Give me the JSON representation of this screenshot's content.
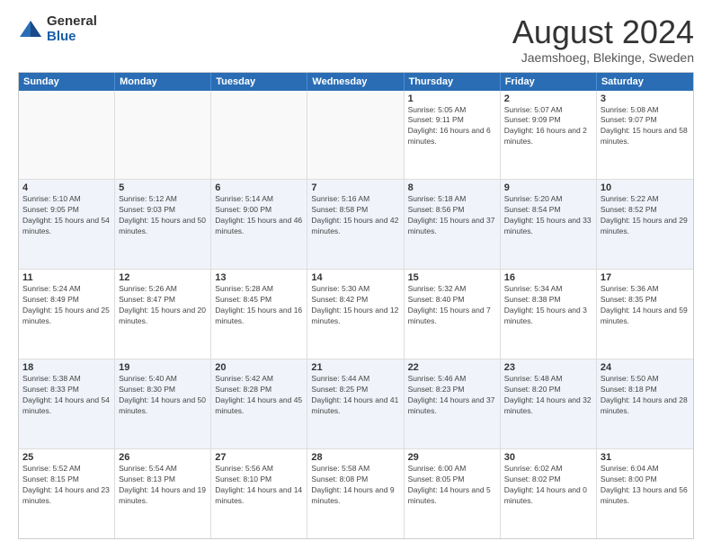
{
  "logo": {
    "general": "General",
    "blue": "Blue"
  },
  "title": "August 2024",
  "subtitle": "Jaemshoeg, Blekinge, Sweden",
  "dayNames": [
    "Sunday",
    "Monday",
    "Tuesday",
    "Wednesday",
    "Thursday",
    "Friday",
    "Saturday"
  ],
  "weeks": [
    [
      {
        "date": "",
        "sunrise": "",
        "sunset": "",
        "daylight": ""
      },
      {
        "date": "",
        "sunrise": "",
        "sunset": "",
        "daylight": ""
      },
      {
        "date": "",
        "sunrise": "",
        "sunset": "",
        "daylight": ""
      },
      {
        "date": "",
        "sunrise": "",
        "sunset": "",
        "daylight": ""
      },
      {
        "date": "1",
        "sunrise": "Sunrise: 5:05 AM",
        "sunset": "Sunset: 9:11 PM",
        "daylight": "Daylight: 16 hours and 6 minutes."
      },
      {
        "date": "2",
        "sunrise": "Sunrise: 5:07 AM",
        "sunset": "Sunset: 9:09 PM",
        "daylight": "Daylight: 16 hours and 2 minutes."
      },
      {
        "date": "3",
        "sunrise": "Sunrise: 5:08 AM",
        "sunset": "Sunset: 9:07 PM",
        "daylight": "Daylight: 15 hours and 58 minutes."
      }
    ],
    [
      {
        "date": "4",
        "sunrise": "Sunrise: 5:10 AM",
        "sunset": "Sunset: 9:05 PM",
        "daylight": "Daylight: 15 hours and 54 minutes."
      },
      {
        "date": "5",
        "sunrise": "Sunrise: 5:12 AM",
        "sunset": "Sunset: 9:03 PM",
        "daylight": "Daylight: 15 hours and 50 minutes."
      },
      {
        "date": "6",
        "sunrise": "Sunrise: 5:14 AM",
        "sunset": "Sunset: 9:00 PM",
        "daylight": "Daylight: 15 hours and 46 minutes."
      },
      {
        "date": "7",
        "sunrise": "Sunrise: 5:16 AM",
        "sunset": "Sunset: 8:58 PM",
        "daylight": "Daylight: 15 hours and 42 minutes."
      },
      {
        "date": "8",
        "sunrise": "Sunrise: 5:18 AM",
        "sunset": "Sunset: 8:56 PM",
        "daylight": "Daylight: 15 hours and 37 minutes."
      },
      {
        "date": "9",
        "sunrise": "Sunrise: 5:20 AM",
        "sunset": "Sunset: 8:54 PM",
        "daylight": "Daylight: 15 hours and 33 minutes."
      },
      {
        "date": "10",
        "sunrise": "Sunrise: 5:22 AM",
        "sunset": "Sunset: 8:52 PM",
        "daylight": "Daylight: 15 hours and 29 minutes."
      }
    ],
    [
      {
        "date": "11",
        "sunrise": "Sunrise: 5:24 AM",
        "sunset": "Sunset: 8:49 PM",
        "daylight": "Daylight: 15 hours and 25 minutes."
      },
      {
        "date": "12",
        "sunrise": "Sunrise: 5:26 AM",
        "sunset": "Sunset: 8:47 PM",
        "daylight": "Daylight: 15 hours and 20 minutes."
      },
      {
        "date": "13",
        "sunrise": "Sunrise: 5:28 AM",
        "sunset": "Sunset: 8:45 PM",
        "daylight": "Daylight: 15 hours and 16 minutes."
      },
      {
        "date": "14",
        "sunrise": "Sunrise: 5:30 AM",
        "sunset": "Sunset: 8:42 PM",
        "daylight": "Daylight: 15 hours and 12 minutes."
      },
      {
        "date": "15",
        "sunrise": "Sunrise: 5:32 AM",
        "sunset": "Sunset: 8:40 PM",
        "daylight": "Daylight: 15 hours and 7 minutes."
      },
      {
        "date": "16",
        "sunrise": "Sunrise: 5:34 AM",
        "sunset": "Sunset: 8:38 PM",
        "daylight": "Daylight: 15 hours and 3 minutes."
      },
      {
        "date": "17",
        "sunrise": "Sunrise: 5:36 AM",
        "sunset": "Sunset: 8:35 PM",
        "daylight": "Daylight: 14 hours and 59 minutes."
      }
    ],
    [
      {
        "date": "18",
        "sunrise": "Sunrise: 5:38 AM",
        "sunset": "Sunset: 8:33 PM",
        "daylight": "Daylight: 14 hours and 54 minutes."
      },
      {
        "date": "19",
        "sunrise": "Sunrise: 5:40 AM",
        "sunset": "Sunset: 8:30 PM",
        "daylight": "Daylight: 14 hours and 50 minutes."
      },
      {
        "date": "20",
        "sunrise": "Sunrise: 5:42 AM",
        "sunset": "Sunset: 8:28 PM",
        "daylight": "Daylight: 14 hours and 45 minutes."
      },
      {
        "date": "21",
        "sunrise": "Sunrise: 5:44 AM",
        "sunset": "Sunset: 8:25 PM",
        "daylight": "Daylight: 14 hours and 41 minutes."
      },
      {
        "date": "22",
        "sunrise": "Sunrise: 5:46 AM",
        "sunset": "Sunset: 8:23 PM",
        "daylight": "Daylight: 14 hours and 37 minutes."
      },
      {
        "date": "23",
        "sunrise": "Sunrise: 5:48 AM",
        "sunset": "Sunset: 8:20 PM",
        "daylight": "Daylight: 14 hours and 32 minutes."
      },
      {
        "date": "24",
        "sunrise": "Sunrise: 5:50 AM",
        "sunset": "Sunset: 8:18 PM",
        "daylight": "Daylight: 14 hours and 28 minutes."
      }
    ],
    [
      {
        "date": "25",
        "sunrise": "Sunrise: 5:52 AM",
        "sunset": "Sunset: 8:15 PM",
        "daylight": "Daylight: 14 hours and 23 minutes."
      },
      {
        "date": "26",
        "sunrise": "Sunrise: 5:54 AM",
        "sunset": "Sunset: 8:13 PM",
        "daylight": "Daylight: 14 hours and 19 minutes."
      },
      {
        "date": "27",
        "sunrise": "Sunrise: 5:56 AM",
        "sunset": "Sunset: 8:10 PM",
        "daylight": "Daylight: 14 hours and 14 minutes."
      },
      {
        "date": "28",
        "sunrise": "Sunrise: 5:58 AM",
        "sunset": "Sunset: 8:08 PM",
        "daylight": "Daylight: 14 hours and 9 minutes."
      },
      {
        "date": "29",
        "sunrise": "Sunrise: 6:00 AM",
        "sunset": "Sunset: 8:05 PM",
        "daylight": "Daylight: 14 hours and 5 minutes."
      },
      {
        "date": "30",
        "sunrise": "Sunrise: 6:02 AM",
        "sunset": "Sunset: 8:02 PM",
        "daylight": "Daylight: 14 hours and 0 minutes."
      },
      {
        "date": "31",
        "sunrise": "Sunrise: 6:04 AM",
        "sunset": "Sunset: 8:00 PM",
        "daylight": "Daylight: 13 hours and 56 minutes."
      }
    ]
  ]
}
